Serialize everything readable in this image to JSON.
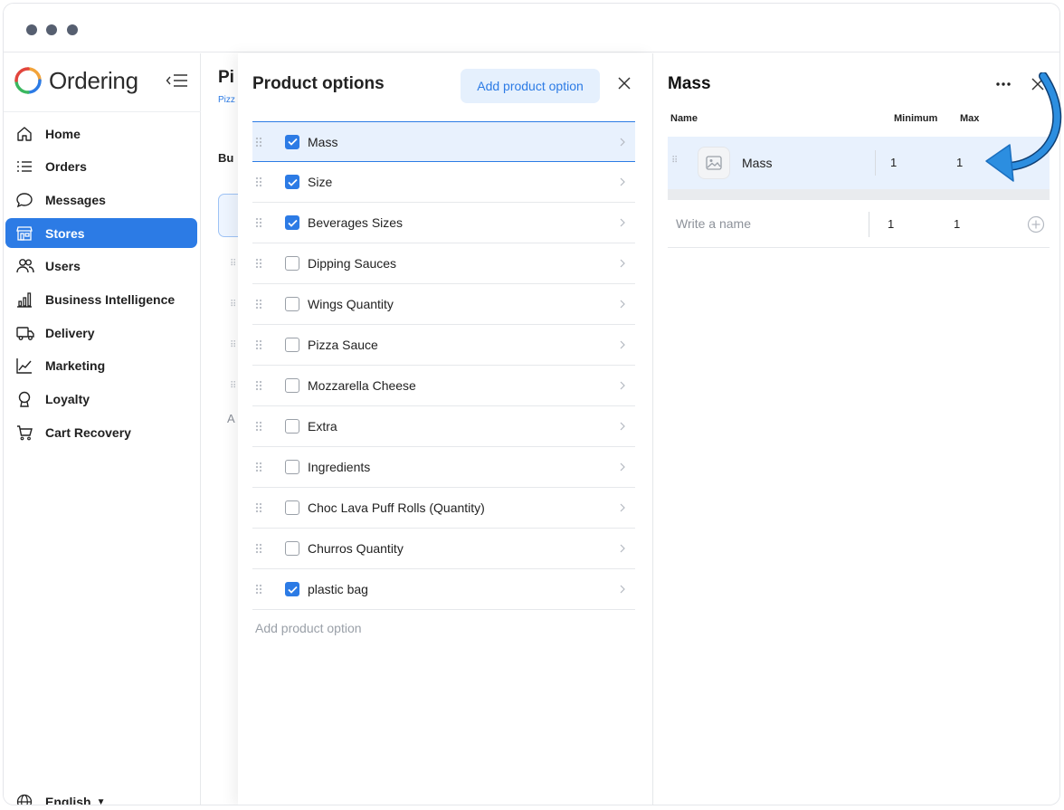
{
  "window": {
    "accent": "#2c7be5"
  },
  "sidebar": {
    "logo_text": "Ordering",
    "items": [
      {
        "label": "Home",
        "icon": "home-icon"
      },
      {
        "label": "Orders",
        "icon": "list-icon"
      },
      {
        "label": "Messages",
        "icon": "chat-bubble-icon"
      },
      {
        "label": "Stores",
        "icon": "store-icon",
        "active": true
      },
      {
        "label": "Users",
        "icon": "users-icon"
      },
      {
        "label": "Business Intelligence",
        "icon": "bar-chart-icon"
      },
      {
        "label": "Delivery",
        "icon": "truck-icon"
      },
      {
        "label": "Marketing",
        "icon": "line-chart-icon"
      },
      {
        "label": "Loyalty",
        "icon": "award-icon"
      },
      {
        "label": "Cart Recovery",
        "icon": "cart-icon"
      }
    ],
    "language": "English"
  },
  "background_page": {
    "title_fragment": "Pi",
    "link_fragment": "Pizz",
    "sub_fragment": "Bu",
    "letter_fragment": "A"
  },
  "options_panel": {
    "title": "Product options",
    "add_button": "Add product option",
    "add_link": "Add product option",
    "options": [
      {
        "name": "Mass",
        "checked": true,
        "selected": true
      },
      {
        "name": "Size",
        "checked": true
      },
      {
        "name": "Beverages Sizes",
        "checked": true
      },
      {
        "name": "Dipping Sauces",
        "checked": false
      },
      {
        "name": "Wings Quantity",
        "checked": false
      },
      {
        "name": "Pizza Sauce",
        "checked": false
      },
      {
        "name": "Mozzarella Cheese",
        "checked": false
      },
      {
        "name": "Extra",
        "checked": false
      },
      {
        "name": "Ingredients",
        "checked": false
      },
      {
        "name": "Choc Lava Puff Rolls (Quantity)",
        "checked": false
      },
      {
        "name": "Churros Quantity",
        "checked": false
      },
      {
        "name": "plastic bag",
        "checked": true
      }
    ]
  },
  "detail_panel": {
    "title": "Mass",
    "columns": {
      "name": "Name",
      "minimum": "Minimum",
      "max": "Max"
    },
    "suboption": {
      "name": "Mass",
      "min": "1",
      "max": "1"
    },
    "new_row": {
      "placeholder": "Write a name",
      "min": "1",
      "max": "1"
    },
    "arrow_color": "#2c8ee0"
  }
}
